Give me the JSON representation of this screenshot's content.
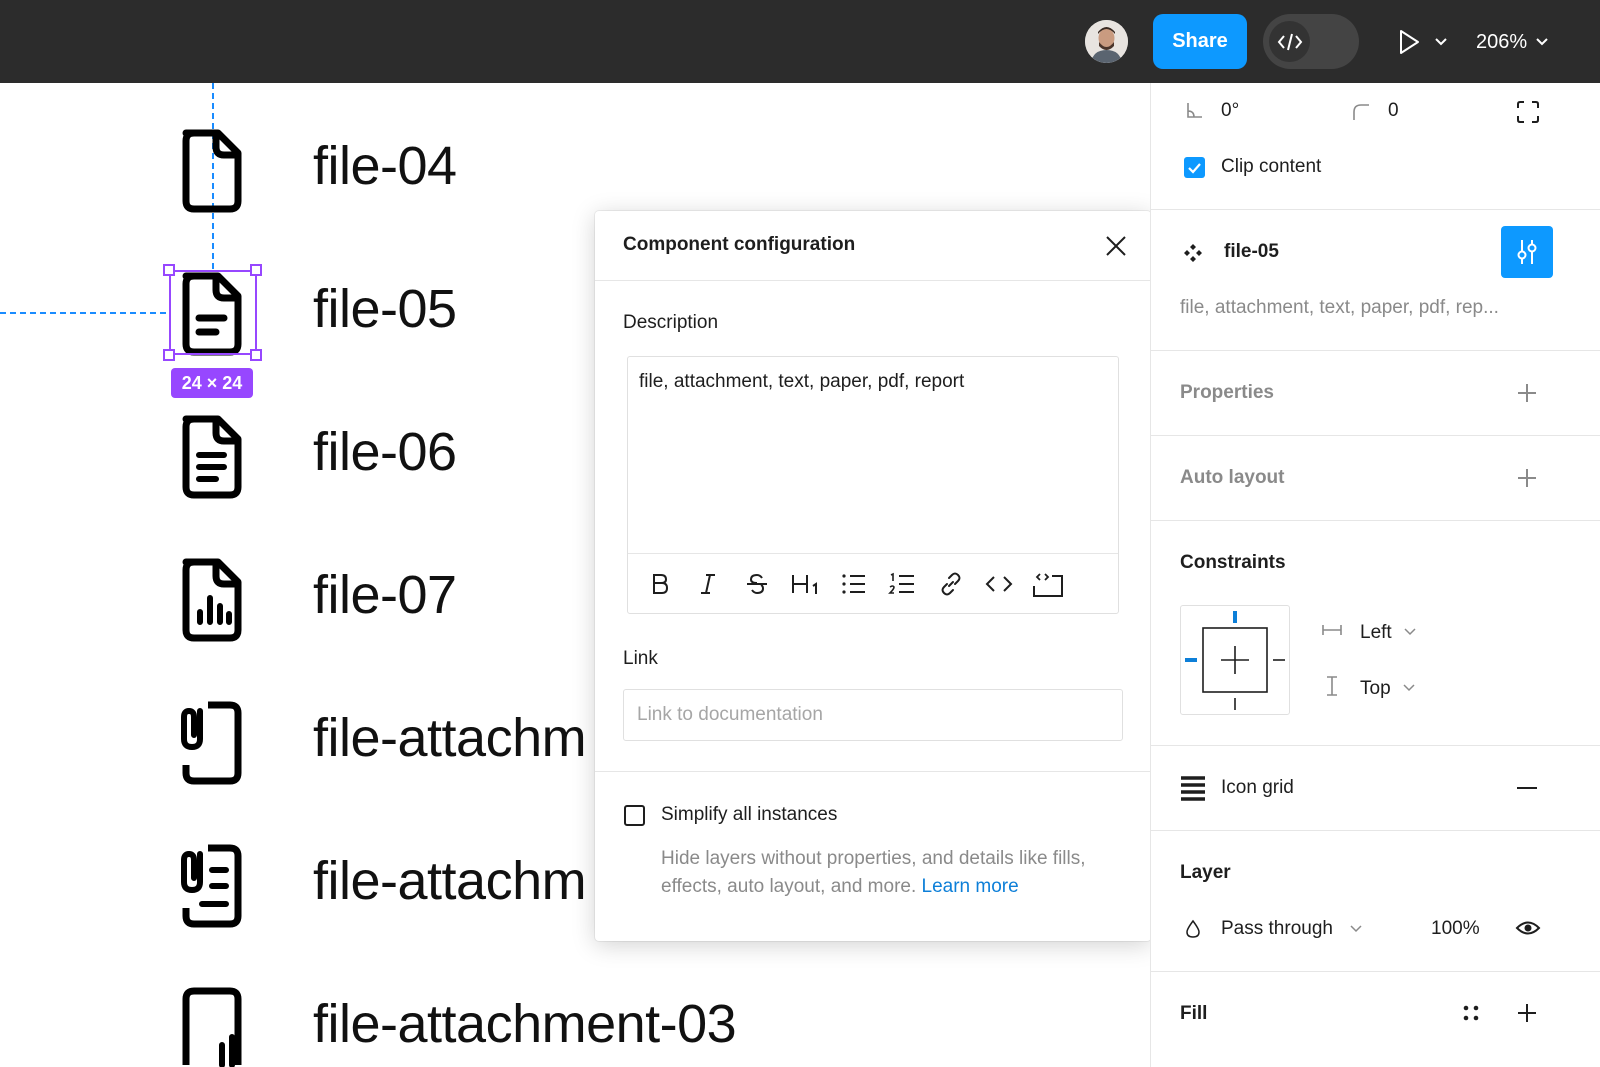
{
  "topbar": {
    "share_label": "Share",
    "zoom_label": "206%"
  },
  "canvas": {
    "rows": [
      {
        "label": "file-04",
        "icon": "file-icon"
      },
      {
        "label": "file-05",
        "icon": "file-text-icon"
      },
      {
        "label": "file-06",
        "icon": "file-lines-icon"
      },
      {
        "label": "file-07",
        "icon": "file-chart-icon"
      },
      {
        "label": "file-attachm",
        "icon": "file-attachment-icon"
      },
      {
        "label": "file-attachm",
        "icon": "file-attachment-text-icon"
      },
      {
        "label": "file-attachment-03",
        "icon": "file-attachment-chart-icon"
      }
    ],
    "selection_size": "24 × 24"
  },
  "dialog": {
    "title": "Component configuration",
    "description_label": "Description",
    "description_value": "file, attachment, text, paper, pdf, report",
    "link_label": "Link",
    "link_placeholder": "Link to documentation",
    "simplify_label": "Simplify all instances",
    "simplify_help": "Hide layers without properties, and details like fills, effects, auto layout, and more.",
    "learn_more": "Learn more",
    "toolbar": [
      "bold-icon",
      "italic-icon",
      "strikethrough-icon",
      "heading-icon",
      "bullet-list-icon",
      "numbered-list-icon",
      "link-icon",
      "code-icon",
      "code-block-icon"
    ]
  },
  "panel": {
    "rotation": "0°",
    "corner_radius": "0",
    "clip_content": "Clip content",
    "component_name": "file-05",
    "component_desc": "file, attachment, text, paper, pdf, rep...",
    "properties": "Properties",
    "auto_layout": "Auto layout",
    "constraints": "Constraints",
    "constraint_h": "Left",
    "constraint_v": "Top",
    "icon_grid": "Icon grid",
    "layer": "Layer",
    "blend_mode": "Pass through",
    "opacity": "100%",
    "fill": "Fill"
  },
  "colors": {
    "accent": "#0d99ff",
    "selection": "#9747ff",
    "topbar": "#2c2c2c",
    "link": "#0d7fd8"
  }
}
